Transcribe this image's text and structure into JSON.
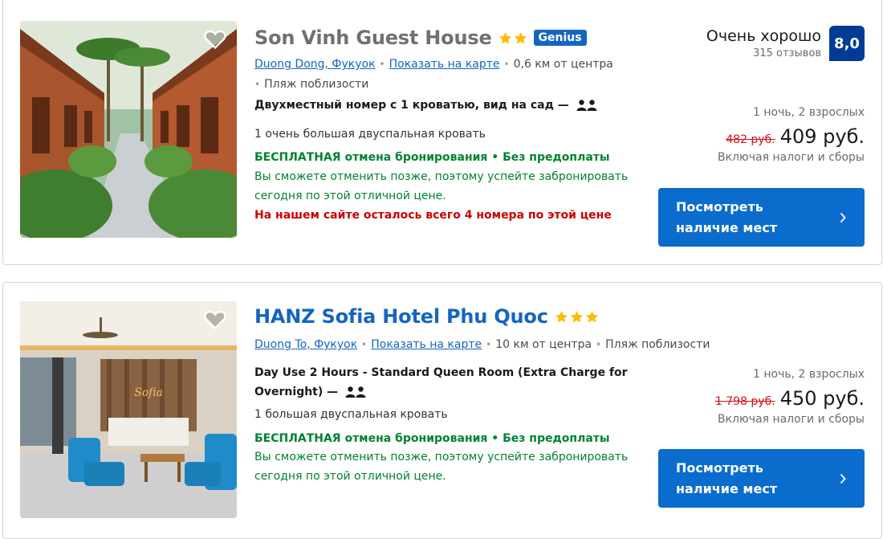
{
  "colors": {
    "link": "#1565c0",
    "green": "#008234",
    "red_warning": "#cc0000",
    "old_price": "#d4111e",
    "score_bg": "#003b95",
    "button_bg": "#0a6ccd",
    "star": "#febb02"
  },
  "listings": [
    {
      "name": "Son Vinh Guest House",
      "stars": 2,
      "genius_label": "Genius",
      "location_link": "Duong Dong, Фукуок",
      "map_link": "Показать на карте",
      "distance": "0,6 км от центра",
      "beach": "Пляж поблизости",
      "room_title": "Двухместный номер с 1 кроватью, вид на сад",
      "room_separator": "—",
      "bed": "1 очень большая двуспальная кровать",
      "free_cancel": "БЕСПЛАТНАЯ отмена бронирования • Без предоплаты",
      "free_note": "Вы сможете отменить позже, поэтому успейте забронировать сегодня по этой отличной цене.",
      "scarcity": "На нашем сайте осталось всего 4 номера по этой цене",
      "rating_word": "Очень хорошо",
      "reviews": "315 отзывов",
      "score": "8,0",
      "nights": "1 ночь, 2 взрослых",
      "old_price": "482 руб.",
      "price": "409 руб.",
      "taxes": "Включая налоги и сборы",
      "button": "Посмотреть наличие мест",
      "button_icon": "chevron-right-icon"
    },
    {
      "name": "HANZ Sofia Hotel Phu Quoc",
      "stars": 3,
      "location_link": "Duong To, Фукуок",
      "map_link": "Показать на карте",
      "distance": "10 км от центра",
      "beach": "Пляж поблизости",
      "room_title": "Day Use 2 Hours - Standard Queen Room (Extra Charge for Overnight)",
      "room_separator": "—",
      "bed": "1 большая двуспальная кровать",
      "free_cancel": "БЕСПЛАТНАЯ отмена бронирования • Без предоплаты",
      "free_note": "Вы сможете отменить позже, поэтому успейте забронировать сегодня по этой отличной цене.",
      "nights": "1 ночь, 2 взрослых",
      "old_price": "1 798 руб.",
      "price": "450 руб.",
      "taxes": "Включая налоги и сборы",
      "button": "Посмотреть наличие мест",
      "button_icon": "chevron-right-icon",
      "photo_sign": "Sofia"
    }
  ]
}
